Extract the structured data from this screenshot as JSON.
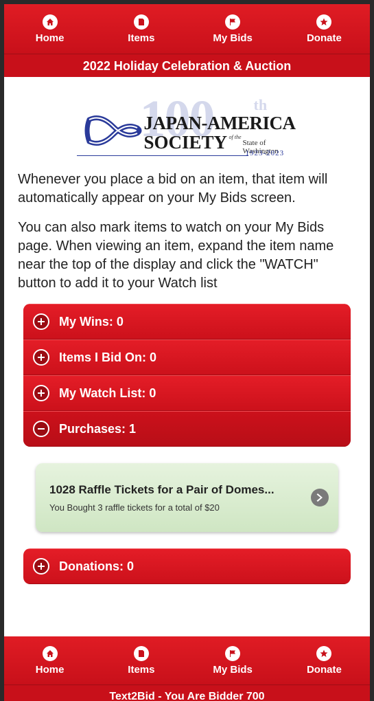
{
  "top_nav": [
    {
      "label": "Home",
      "icon": "home-icon"
    },
    {
      "label": "Items",
      "icon": "items-icon"
    },
    {
      "label": "My Bids",
      "icon": "flag-icon"
    },
    {
      "label": "Donate",
      "icon": "star-icon"
    }
  ],
  "header": {
    "title": "2022 Holiday Celebration & Auction"
  },
  "logo": {
    "line1": "JAPAN-AMERICA",
    "line2": "SOCIETY",
    "of_the": "of the",
    "state": "State of Washington",
    "years": "1923-2023",
    "anniversary": "100",
    "anniversary_suffix": "th"
  },
  "info": {
    "paragraph1": "Whenever you place a bid on an item, that item will automatically appear on your My Bids screen.",
    "paragraph2": "You can also mark items to watch on your My Bids page. When viewing an item, expand the item name near the top of the display and click the \"WATCH\" button to add it to your Watch list"
  },
  "sections": [
    {
      "label": "My Wins: 0",
      "state": "collapsed"
    },
    {
      "label": "Items I Bid On: 0",
      "state": "collapsed"
    },
    {
      "label": "My Watch List: 0",
      "state": "collapsed"
    },
    {
      "label": "Purchases: 1",
      "state": "expanded"
    },
    {
      "label": "Donations: 0",
      "state": "collapsed"
    }
  ],
  "purchase": {
    "title": "1028 Raffle Tickets for a Pair of Domes...",
    "subtitle": "You Bought 3 raffle tickets for a total of $20"
  },
  "bottom_nav": [
    {
      "label": "Home",
      "icon": "home-icon"
    },
    {
      "label": "Items",
      "icon": "items-icon"
    },
    {
      "label": "My Bids",
      "icon": "flag-icon"
    },
    {
      "label": "Donate",
      "icon": "star-icon"
    }
  ],
  "footer": {
    "text": "Text2Bid - You Are Bidder 700"
  },
  "colors": {
    "brand_red": "#c8101a",
    "card_green": "#d8ecce",
    "logo_blue": "#2a3a9a"
  }
}
